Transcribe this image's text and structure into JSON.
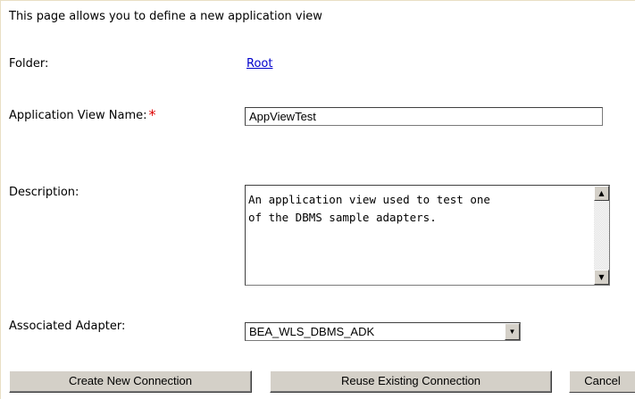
{
  "intro_text": "This page allows you to define a new application view",
  "folder": {
    "label": "Folder:",
    "link_text": "Root"
  },
  "app_view_name": {
    "label": "Application View Name:",
    "required_marker": "*",
    "value": "AppViewTest"
  },
  "description": {
    "label": "Description:",
    "value": "An application view used to test one\nof the DBMS sample adapters."
  },
  "associated_adapter": {
    "label": "Associated Adapter:",
    "selected": "BEA_WLS_DBMS_ADK"
  },
  "buttons": {
    "create_new_connection": "Create New Connection",
    "reuse_existing_connection": "Reuse Existing Connection",
    "cancel": "Cancel"
  },
  "icons": {
    "scroll_up": "scroll-up-arrow-icon",
    "scroll_down": "scroll-down-arrow-icon",
    "dropdown": "chevron-down-icon"
  },
  "colors": {
    "link": "#0000cc",
    "required": "#dd0000",
    "button_face": "#d4d0c8"
  }
}
